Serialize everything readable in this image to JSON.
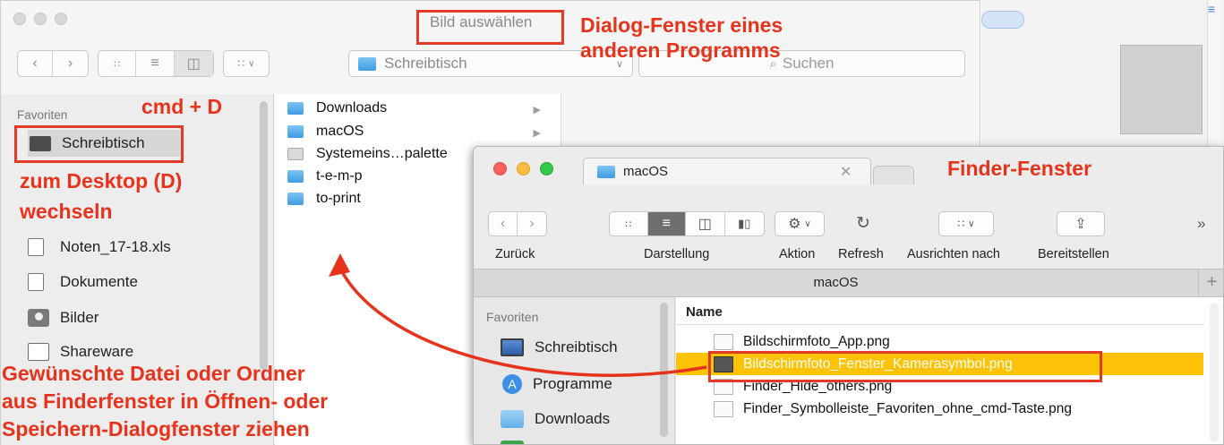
{
  "dialog": {
    "title": "Bild auswählen",
    "location": "Schreibtisch",
    "search_placeholder": "Suchen",
    "sidebar": {
      "section": "Favoriten",
      "items": [
        {
          "label": "Schreibtisch",
          "icon": "desktop-icon"
        },
        {
          "label": "Noten_17-18.xls",
          "icon": "document-icon"
        },
        {
          "label": "Dokumente",
          "icon": "documents-icon"
        },
        {
          "label": "Bilder",
          "icon": "camera-icon"
        },
        {
          "label": "Shareware",
          "icon": "folder-icon"
        }
      ]
    },
    "column": [
      {
        "label": "Downloads",
        "icon": "downloads-folder-icon",
        "has_children": true
      },
      {
        "label": "macOS",
        "icon": "folder-icon",
        "has_children": true
      },
      {
        "label": "Systemeins…palette",
        "icon": "file-icon",
        "has_children": false
      },
      {
        "label": "t-e-m-p",
        "icon": "folder-icon",
        "has_children": false
      },
      {
        "label": "to-print",
        "icon": "folder-icon",
        "has_children": false
      }
    ]
  },
  "annotations": {
    "dialog_title": "Dialog-Fenster eines",
    "dialog_title_2": "anderen Programms",
    "shortcut": "cmd + D",
    "desktop_line1": "zum Desktop (D)",
    "desktop_line2": "wechseln",
    "finder_title": "Finder-Fenster",
    "drag_line1": "Gewünschte Datei oder Ordner",
    "drag_line2": "aus Finderfenster in Öffnen- oder",
    "drag_line3": "Speichern-Dialogfenster ziehen"
  },
  "finder": {
    "tab_title": "macOS",
    "path_title": "macOS",
    "toolbar": {
      "back": "Zurück",
      "view": "Darstellung",
      "action": "Aktion",
      "refresh": "Refresh",
      "arrange": "Ausrichten nach",
      "share": "Bereitstellen"
    },
    "sidebar": {
      "section": "Favoriten",
      "items": [
        {
          "label": "Schreibtisch",
          "icon": "desktop-icon"
        },
        {
          "label": "Programme",
          "icon": "apps-icon"
        },
        {
          "label": "Downloads",
          "icon": "downloads-folder-icon"
        }
      ]
    },
    "list_header": "Name",
    "files": [
      {
        "name": "Bildschirmfoto_App.png",
        "selected": false
      },
      {
        "name": "Bildschirmfoto_Fenster_Kamerasymbol.png",
        "selected": true
      },
      {
        "name": "Finder_Hide_others.png",
        "selected": false
      },
      {
        "name": "Finder_Symbolleiste_Favoriten_ohne_cmd-Taste.png",
        "selected": false
      }
    ]
  },
  "colors": {
    "annotation": "#e8331c",
    "selection": "#fec306",
    "folder_blue": "#5aaee9"
  }
}
